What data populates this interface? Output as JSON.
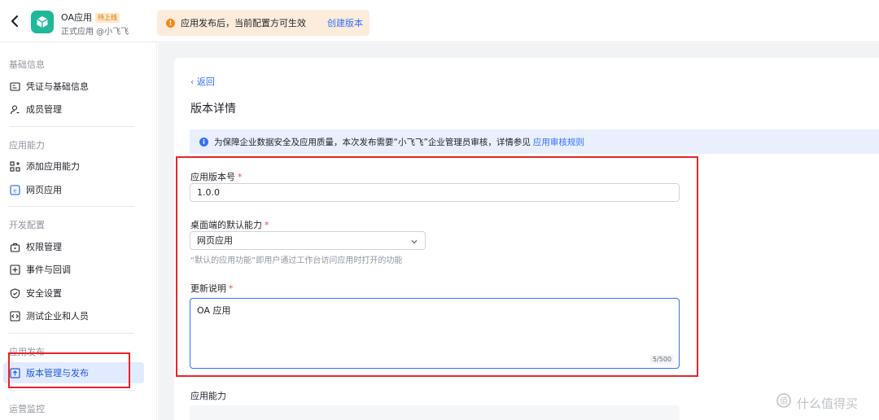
{
  "header": {
    "app_name": "OA应用",
    "app_badge": "待上线",
    "app_subtitle": "正式应用 @小飞飞",
    "notice_text": "应用发布后，当前配置方可生效",
    "notice_link": "创建版本"
  },
  "sidebar": {
    "groups": [
      {
        "title": "基础信息",
        "items": [
          {
            "label": "凭证与基础信息",
            "icon": "id-card-icon"
          },
          {
            "label": "成员管理",
            "icon": "user-icon"
          }
        ]
      },
      {
        "title": "应用能力",
        "items": [
          {
            "label": "添加应用能力",
            "icon": "apps-add-icon"
          },
          {
            "label": "网页应用",
            "icon": "web-app-icon"
          }
        ]
      },
      {
        "title": "开发配置",
        "items": [
          {
            "label": "权限管理",
            "icon": "lock-icon"
          },
          {
            "label": "事件与回调",
            "icon": "event-icon"
          },
          {
            "label": "安全设置",
            "icon": "shield-icon"
          },
          {
            "label": "测试企业和人员",
            "icon": "code-icon"
          }
        ]
      },
      {
        "title": "应用发布",
        "items": [
          {
            "label": "版本管理与发布",
            "icon": "upload-icon",
            "active": true
          }
        ]
      },
      {
        "title": "运营监控",
        "items": []
      }
    ]
  },
  "main": {
    "back_label": "返回",
    "page_title": "版本详情",
    "info_text": "为保障企业数据安全及应用质量，本次发布需要“小飞飞”企业管理员审核，详情参见",
    "info_link": "应用审核规则",
    "version_label": "应用版本号",
    "version_value": "1.0.0",
    "default_ability_label": "桌面端的默认能力",
    "default_ability_value": "网页应用",
    "default_ability_hint": "“默认的应用功能”即用户通过工作台访问应用时打开的功能",
    "update_notes_label": "更新说明",
    "update_notes_value": "OA 应用",
    "update_notes_counter": "5/500",
    "capability_section_label": "应用能力"
  },
  "watermark": {
    "text": "什么值得买"
  },
  "colors": {
    "primary": "#3370ff",
    "active_bg": "#e1eaff",
    "warning": "#f08a19",
    "annotation": "#e5252a",
    "app_icon": "#1fb89a"
  }
}
